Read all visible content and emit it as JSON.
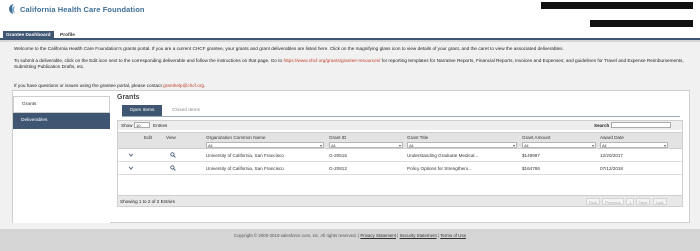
{
  "header": {
    "logo_text": "California Health Care Foundation"
  },
  "tabs": [
    {
      "label": "Grantee Dashboard",
      "active": true
    },
    {
      "label": "Profile",
      "active": false
    }
  ],
  "intro": {
    "p1": "Welcome to the California Health Care Foundation's grants portal. If you are a current CHCF grantee, your grants and grant deliverables are listed here. Click on the magnifying glass icon to view details of your grant, and the caret to view the associated deliverables.",
    "p2_before": "To submit a deliverable, click on the Edit icon next to the corresponding deliverable and follow the instructions on that page. Go to ",
    "p2_link": "https://www.chcf.org/grants/grantee-resources/",
    "p2_after": " for reporting templates for Narrative Reports, Financial Reports, Invoices and Expenses; and guidelines for Travel and Expense Reimbursements, Submitting Publication Drafts, etc.",
    "p3_before": "If you have questions or issues using the grantee portal, please contact ",
    "p3_link": "granthelp@chcf.org",
    "p3_after": "."
  },
  "sidebar": {
    "items": [
      {
        "label": "Grants",
        "active": true
      },
      {
        "label": "Deliverables",
        "active": false
      }
    ]
  },
  "grants": {
    "title": "Grants",
    "sub_tabs": [
      {
        "label": "Open Items",
        "active": true
      },
      {
        "label": "Closed Items",
        "active": false
      }
    ],
    "show_label": "Show",
    "show_value": "10",
    "entries_label": "Entries",
    "search_label": "Search",
    "columns": [
      "Edit",
      "View",
      "Organization Common Name",
      "Grant ID",
      "Grant Title",
      "Grant Amount",
      "Award Date"
    ],
    "filter_value": "All",
    "rows": [
      {
        "org": "University of California, San Francisco",
        "grant_id": "G-20516",
        "title": "Understanding Graduate Medical...",
        "amount": "$149997",
        "date": "12/20/2017"
      },
      {
        "org": "University of California, San Francisco",
        "grant_id": "G-20812",
        "title": "Policy Options for Strengtheni...",
        "amount": "$164786",
        "date": "07/12/2018"
      }
    ],
    "showing_text": "Showing 1 to 2 of 2 Entries",
    "pager": [
      "First",
      "Previous",
      "1",
      "Next",
      "Last"
    ]
  },
  "icons": {
    "expand": "chevron-down-icon",
    "view": "magnifying-glass-icon"
  },
  "footer": {
    "copyright": "Copyright © 2000-2019 salesforce.com, inc. All rights reserved.",
    "links": [
      "Privacy Statement",
      "Security Statement",
      "Terms of Use"
    ]
  },
  "colors": {
    "brand": "#3d6f98",
    "nav": "#3f5673",
    "link": "#c23f27"
  }
}
